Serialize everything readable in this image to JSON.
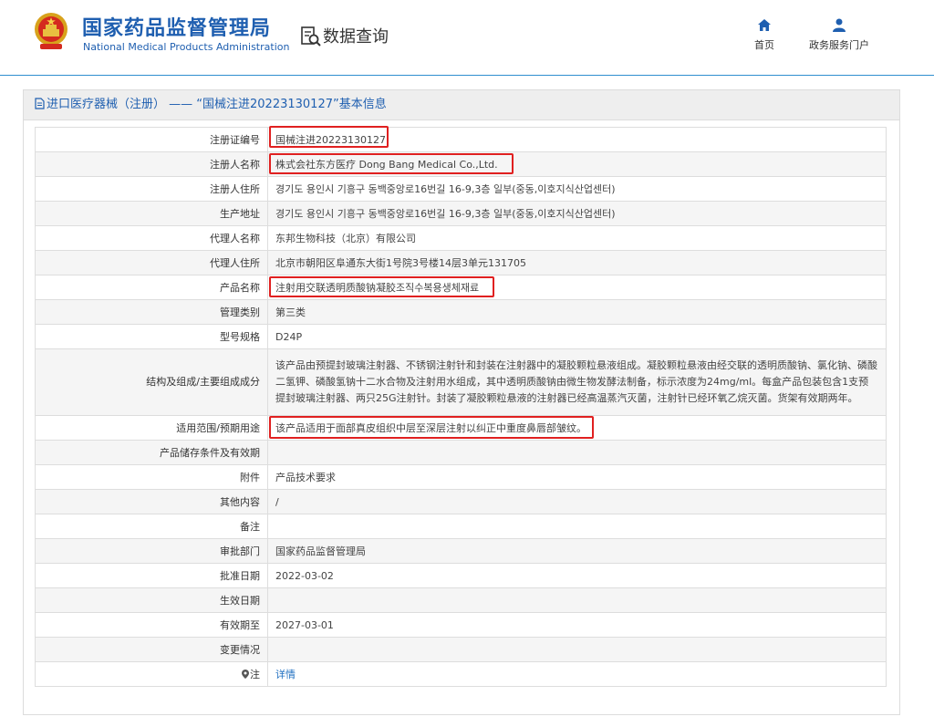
{
  "header": {
    "logo_cn": "国家药品监督管理局",
    "logo_en": "National Medical Products Administration",
    "data_query": "数据查询",
    "nav": [
      {
        "label": "首页",
        "icon": "home-icon"
      },
      {
        "label": "政务服务门户",
        "icon": "user-icon"
      }
    ]
  },
  "panel": {
    "title": "进口医疗器械（注册） —— “国械注进20223130127”基本信息"
  },
  "rows": [
    {
      "label": "注册证编号",
      "value": "国械注进20223130127",
      "highlight": true
    },
    {
      "label": "注册人名称",
      "value": "株式会社东方医疗 Dong Bang Medical Co.,Ltd.",
      "highlight": true
    },
    {
      "label": "注册人住所",
      "value": "경기도 용인시 기흥구 동백중앙로16번길 16-9,3층 일부(중동,이호지식산업센터)"
    },
    {
      "label": "生产地址",
      "value": "경기도 용인시 기흥구 동백중앙로16번길 16-9,3층 일부(중동,이호지식산업센터)"
    },
    {
      "label": "代理人名称",
      "value": "东邦生物科技（北京）有限公司"
    },
    {
      "label": "代理人住所",
      "value": "北京市朝阳区阜通东大街1号院3号楼14层3单元131705"
    },
    {
      "label": "产品名称",
      "value": "注射用交联透明质酸钠凝胶조직수복용생체재료",
      "highlight": true
    },
    {
      "label": "管理类别",
      "value": "第三类"
    },
    {
      "label": "型号规格",
      "value": "D24P"
    },
    {
      "label": "结构及组成/主要组成成分",
      "value": "该产品由预提封玻璃注射器、不锈钢注射针和封装在注射器中的凝胶颗粒悬液组成。凝胶颗粒悬液由经交联的透明质酸钠、氯化钠、磷酸二氢钾、磷酸氢钠十二水合物及注射用水组成，其中透明质酸钠由微生物发酵法制备，标示浓度为24mg/ml。每盒产品包装包含1支预提封玻璃注射器、两只25G注射针。封装了凝胶颗粒悬液的注射器已经高温蒸汽灭菌，注射针已经环氧乙烷灭菌。货架有效期两年。"
    },
    {
      "label": "适用范围/预期用途",
      "value": "该产品适用于面部真皮组织中层至深层注射以纠正中重度鼻唇部皱纹。",
      "highlight": true
    },
    {
      "label": "产品储存条件及有效期",
      "value": ""
    },
    {
      "label": "附件",
      "value": "产品技术要求"
    },
    {
      "label": "其他内容",
      "value": "/"
    },
    {
      "label": "备注",
      "value": ""
    },
    {
      "label": "审批部门",
      "value": "国家药品监督管理局"
    },
    {
      "label": "批准日期",
      "value": "2022-03-02"
    },
    {
      "label": "生效日期",
      "value": ""
    },
    {
      "label": "有效期至",
      "value": "2027-03-01"
    },
    {
      "label": "变更情况",
      "value": ""
    },
    {
      "label": "注",
      "value": "详情",
      "link": true
    }
  ]
}
